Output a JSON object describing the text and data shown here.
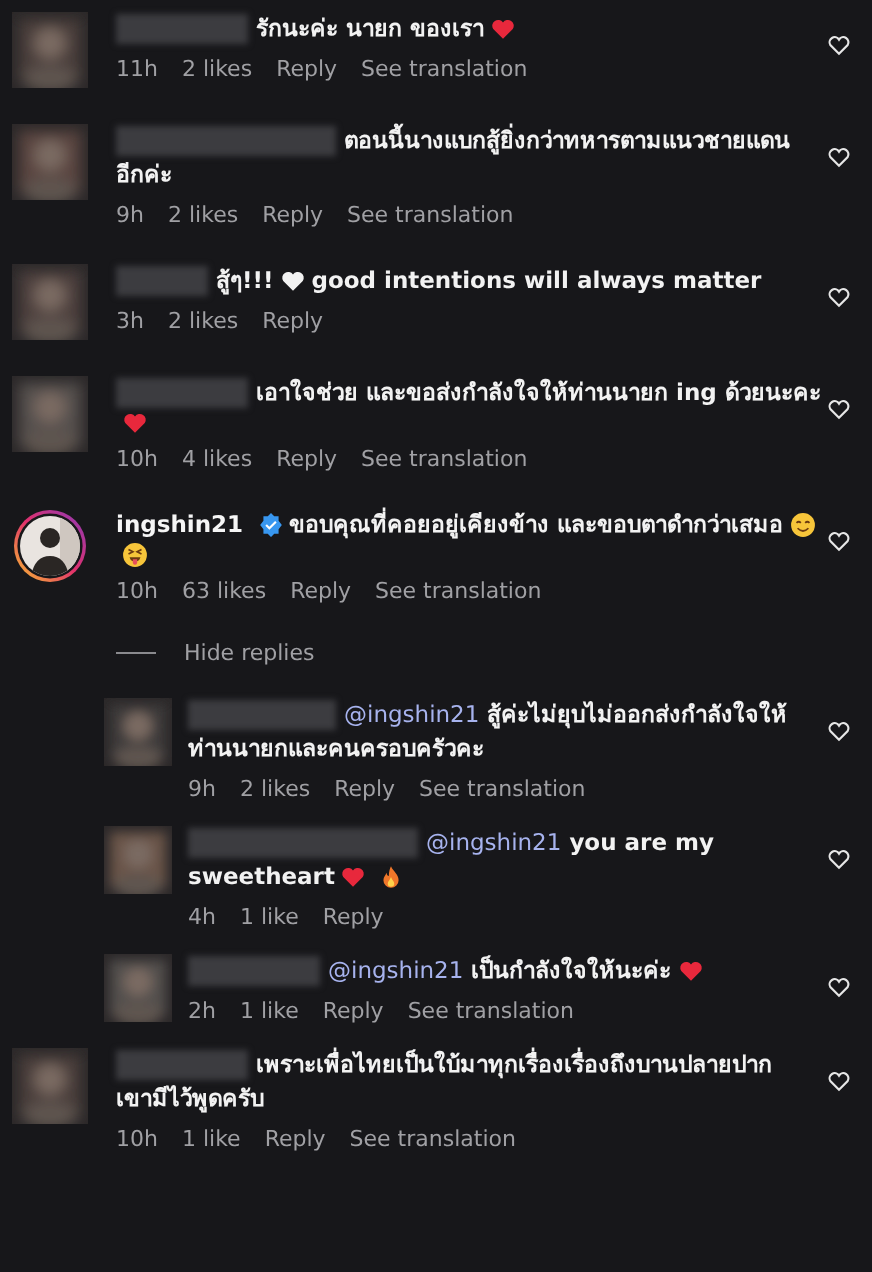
{
  "comments": [
    {
      "author_blurred": true,
      "lines": [
        [
          {
            "kind": "text",
            "text": "รักนะค่ะ นายก ของเรา"
          },
          {
            "kind": "red-heart"
          }
        ]
      ],
      "time": "11h",
      "likes": "2 likes",
      "reply": "Reply",
      "translation": "See translation",
      "liked": false
    },
    {
      "author_blurred": true,
      "lines": [
        [
          {
            "kind": "text",
            "text": "ตอนนี้นางแบกสู้ยิ่งกว่าทหารตามแนวชายแดน"
          }
        ],
        [
          {
            "kind": "text",
            "text": "อีกค่ะ"
          }
        ]
      ],
      "time": "9h",
      "likes": "2 likes",
      "reply": "Reply",
      "translation": "See translation",
      "liked": false
    },
    {
      "author_blurred": true,
      "lines": [
        [
          {
            "kind": "text",
            "text": "สู้ๆ!!!"
          },
          {
            "kind": "white-heart"
          },
          {
            "kind": "text",
            "text": "good intentions will always matter"
          }
        ]
      ],
      "time": "3h",
      "likes": "2 likes",
      "reply": "Reply",
      "liked": false
    },
    {
      "author_blurred": true,
      "lines": [
        [
          {
            "kind": "text",
            "text": "เอาใจช่วย และขอส่งกำลังใจให้ท่านนายก ing ด้วยนะคะ"
          }
        ],
        [
          {
            "kind": "red-heart"
          }
        ]
      ],
      "time": "10h",
      "likes": "4 likes",
      "reply": "Reply",
      "translation": "See translation",
      "liked": false
    },
    {
      "author": "ingshin21",
      "verified": true,
      "story_ring": true,
      "lines": [
        [
          {
            "kind": "text",
            "text": "ขอบคุณที่คอยอยู่เคียงข้าง และขอบตาดำกว่าเสมอ"
          },
          {
            "kind": "smile"
          }
        ],
        [
          {
            "kind": "tongue"
          }
        ]
      ],
      "time": "10h",
      "likes": "63 likes",
      "reply": "Reply",
      "translation": "See translation",
      "liked": false,
      "hide_replies": "Hide replies",
      "replies": [
        {
          "author_blurred": true,
          "mention": "@ingshin21",
          "lines": [
            [
              {
                "kind": "text",
                "text": "สู้ค่ะไม่ยุบไม่ออกส่งกำลังใจให้"
              }
            ],
            [
              {
                "kind": "text",
                "text": "ท่านนายกและคนครอบครัวคะ"
              }
            ]
          ],
          "time": "9h",
          "likes": "2 likes",
          "reply": "Reply",
          "translation": "See translation",
          "liked": false
        },
        {
          "author_blurred": true,
          "mention": "@ingshin21",
          "lines": [
            [
              {
                "kind": "text",
                "text": "you are my"
              }
            ],
            [
              {
                "kind": "text",
                "text": "sweetheart"
              },
              {
                "kind": "red-heart"
              },
              {
                "kind": "fire"
              }
            ]
          ],
          "time": "4h",
          "likes": "1 like",
          "reply": "Reply",
          "liked": false
        },
        {
          "author_blurred": true,
          "mention": "@ingshin21",
          "lines": [
            [
              {
                "kind": "text",
                "text": "เป็นกำลังใจให้นะค่ะ"
              },
              {
                "kind": "red-heart"
              }
            ]
          ],
          "time": "2h",
          "likes": "1 like",
          "reply": "Reply",
          "translation": "See translation",
          "liked": false
        }
      ]
    },
    {
      "author_blurred": true,
      "lines": [
        [
          {
            "kind": "text",
            "text": "เพราะเพื่อไทยเป็นใบ้มาทุกเรื่องเรื่องถึงบานปลายปาก"
          }
        ],
        [
          {
            "kind": "text",
            "text": "เขามีไว้พูดครับ"
          }
        ]
      ],
      "time": "10h",
      "likes": "1 like",
      "reply": "Reply",
      "translation": "See translation",
      "liked": false
    }
  ]
}
